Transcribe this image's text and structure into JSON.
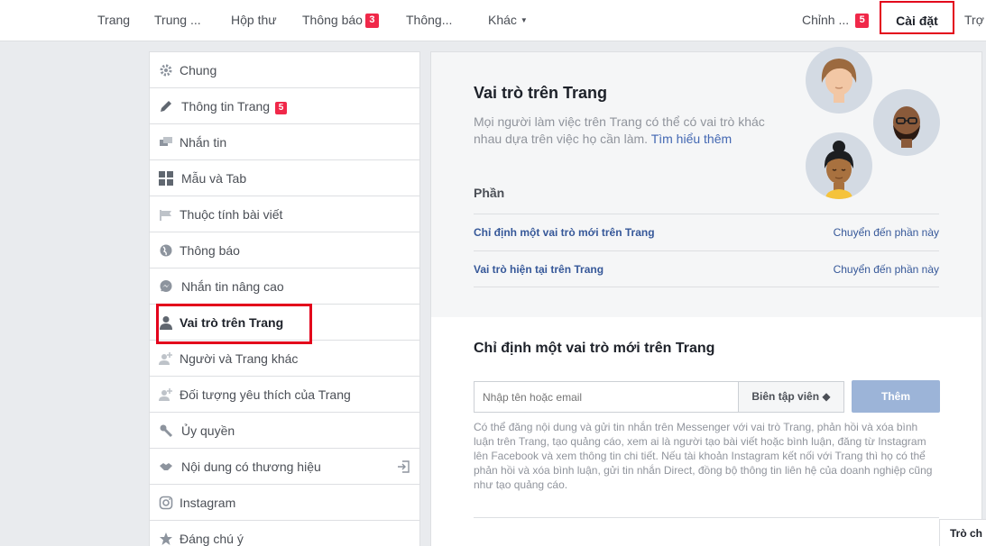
{
  "topnav": {
    "items": [
      {
        "label": "Trang"
      },
      {
        "label": "Trung ..."
      },
      {
        "label": "Hộp thư"
      },
      {
        "label": "Thông báo",
        "badge": "3"
      },
      {
        "label": "Thông..."
      },
      {
        "label": "Khác",
        "caret": "▼"
      }
    ],
    "edit_label": "Chỉnh ...",
    "edit_badge": "5",
    "settings_label": "Cài đặt",
    "help_label": "Trợ"
  },
  "sidebar": {
    "items": [
      {
        "label": "Chung",
        "icon": "gear-icon"
      },
      {
        "label": "Thông tin Trang",
        "icon": "pencil-icon",
        "badge": "5"
      },
      {
        "label": "Nhắn tin",
        "icon": "chat-icon"
      },
      {
        "label": "Mẫu và Tab",
        "icon": "grid-icon"
      },
      {
        "label": "Thuộc tính bài viết",
        "icon": "flag-icon"
      },
      {
        "label": "Thông báo",
        "icon": "globe-icon"
      },
      {
        "label": "Nhắn tin nâng cao",
        "icon": "messenger-icon"
      },
      {
        "label": "Vai trò trên Trang",
        "icon": "person-icon",
        "active": true
      },
      {
        "label": "Người và Trang khác",
        "icon": "person-add-icon"
      },
      {
        "label": "Đối tượng yêu thích của Trang",
        "icon": "person-add-icon"
      },
      {
        "label": "Ủy quyền",
        "icon": "wrench-icon"
      },
      {
        "label": "Nội dung có thương hiệu",
        "icon": "handshake-icon"
      },
      {
        "label": "Instagram",
        "icon": "instagram-icon"
      },
      {
        "label": "Đáng chú ý",
        "icon": "star-icon"
      }
    ]
  },
  "main": {
    "title": "Vai trò trên Trang",
    "description": "Mọi người làm việc trên Trang có thể có vai trò khác nhau dựa trên việc họ cần làm.",
    "learn_more": "Tìm hiểu thêm",
    "section_heading": "Phần",
    "section_rows": [
      {
        "label": "Chỉ định một vai trò mới trên Trang",
        "action": "Chuyển đến phần này"
      },
      {
        "label": "Vai trò hiện tại trên Trang",
        "action": "Chuyển đến phần này"
      }
    ],
    "assign_title": "Chỉ định một vai trò mới trên Trang",
    "input_placeholder": "Nhập tên hoặc email",
    "role_value": "Biên tập viên ◆",
    "add_button": "Thêm",
    "help_text": "Có thể đăng nội dung và gửi tin nhắn trên Messenger với vai trò Trang, phản hồi và xóa bình luận trên Trang, tạo quảng cáo, xem ai là người tạo bài viết hoặc bình luận, đăng từ Instagram lên Facebook và xem thông tin chi tiết. Nếu tài khoản Instagram kết nối với Trang thì họ có thể phản hồi và xóa bình luận, gửi tin nhắn Direct, đồng bộ thông tin liên hệ của doanh nghiệp cũng như tạo quảng cáo."
  },
  "help_tab": "Trò ch",
  "colors": {
    "accent": "#365899",
    "badge": "#f02849",
    "highlight": "#e3001b",
    "button_disabled": "#9cb4d8"
  }
}
